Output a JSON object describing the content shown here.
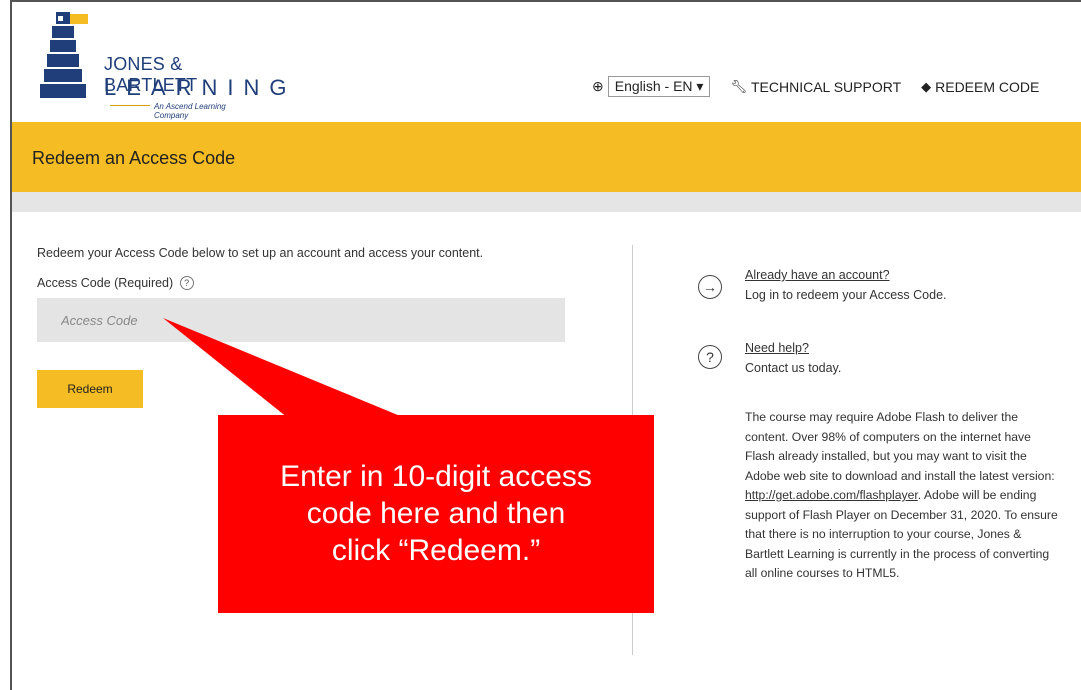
{
  "logo": {
    "line1": "JONES & BARTLETT",
    "line2": "LEARNING",
    "tagline": "An Ascend Learning Company"
  },
  "topnav": {
    "language": "English - EN ▾",
    "technical_support": "TECHNICAL SUPPORT",
    "redeem_code": "REDEEM CODE"
  },
  "banner": {
    "title": "Redeem an Access Code"
  },
  "form": {
    "intro": "Redeem your Access Code below to set up an account and access your content.",
    "label": "Access Code (Required)",
    "placeholder": "Access Code",
    "button": "Redeem"
  },
  "sidebar": {
    "account_link": "Already have an account?",
    "account_sub": "Log in to redeem your Access Code.",
    "help_link": "Need help?",
    "help_sub": "Contact us today.",
    "flash_pre": "The course may require Adobe Flash to deliver the content. Over 98% of computers on the internet have Flash already installed, but you may want to visit the Adobe web site to download and install the latest version: ",
    "flash_link": "http://get.adobe.com/flashplayer",
    "flash_post": ". Adobe will be ending support of Flash Player on December 31, 2020. To ensure that there is no interruption to your course, Jones & Bartlett Learning is currently in the process of converting all online courses to HTML5."
  },
  "callout": {
    "line1": "Enter in 10-digit access",
    "line2": "code here and then",
    "line3": "click “Redeem.”"
  },
  "colors": {
    "accent": "#f5bc23",
    "brand": "#1f3e7a",
    "callout": "#ff0000"
  }
}
